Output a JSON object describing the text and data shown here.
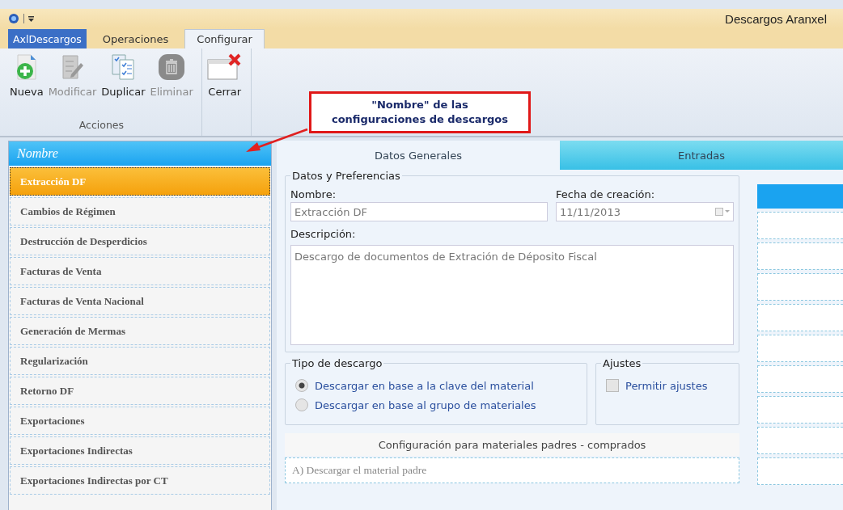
{
  "window": {
    "title": "Descargos Aranxel"
  },
  "ribbon_tabs": [
    {
      "label": "AxlDescargos",
      "kind": "app"
    },
    {
      "label": "Operaciones",
      "kind": "tab",
      "selected": false
    },
    {
      "label": "Configurar",
      "kind": "tab",
      "selected": true
    }
  ],
  "ribbon_groups": [
    {
      "label": "Acciones",
      "buttons": [
        {
          "label": "Nueva",
          "kind": "new",
          "disabled": false
        },
        {
          "label": "Modificar",
          "kind": "edit",
          "disabled": true
        },
        {
          "label": "Duplicar",
          "kind": "duplicate",
          "disabled": false
        },
        {
          "label": "Eliminar",
          "kind": "delete",
          "disabled": true
        }
      ]
    },
    {
      "buttons": [
        {
          "label": "Cerrar",
          "kind": "close",
          "disabled": false
        }
      ]
    }
  ],
  "callout": {
    "line1": "\"Nombre\" de las",
    "line2": "configuraciones de descargos"
  },
  "list": {
    "header": "Nombre",
    "items": [
      {
        "label": "Extracción DF",
        "selected": true
      },
      {
        "label": "Cambios de Régimen",
        "selected": false
      },
      {
        "label": "Destrucción de Desperdicios",
        "selected": false
      },
      {
        "label": "Facturas de Venta",
        "selected": false
      },
      {
        "label": "Facturas de Venta Nacional",
        "selected": false
      },
      {
        "label": "Generación de Mermas",
        "selected": false
      },
      {
        "label": "Regularización",
        "selected": false
      },
      {
        "label": "Retorno DF",
        "selected": false
      },
      {
        "label": "Exportaciones",
        "selected": false
      },
      {
        "label": "Exportaciones Indirectas",
        "selected": false
      },
      {
        "label": "Exportaciones Indirectas por CT",
        "selected": false
      }
    ]
  },
  "tabs": [
    {
      "label": "Datos Generales",
      "selected": true
    },
    {
      "label": "Entradas",
      "selected": false
    }
  ],
  "datos": {
    "legend": "Datos y Preferencias",
    "nombre_label": "Nombre:",
    "nombre_value": "Extracción DF",
    "fecha_label": "Fecha de creación:",
    "fecha_value": "11/11/2013",
    "descripcion_label": "Descripción:",
    "descripcion_value": "Descargo de documentos de Extración de Déposito Fiscal"
  },
  "tipo": {
    "legend": "Tipo de descargo",
    "options": [
      {
        "label": "Descargar en base a la clave del material",
        "selected": true
      },
      {
        "label": "Descargar en base al grupo de materiales",
        "selected": false
      }
    ]
  },
  "ajustes": {
    "legend": "Ajustes",
    "checkbox": {
      "label": "Permitir ajustes",
      "checked": false
    }
  },
  "config": {
    "title": "Configuración para materiales padres - comprados",
    "option": "A) Descargar el material padre"
  }
}
